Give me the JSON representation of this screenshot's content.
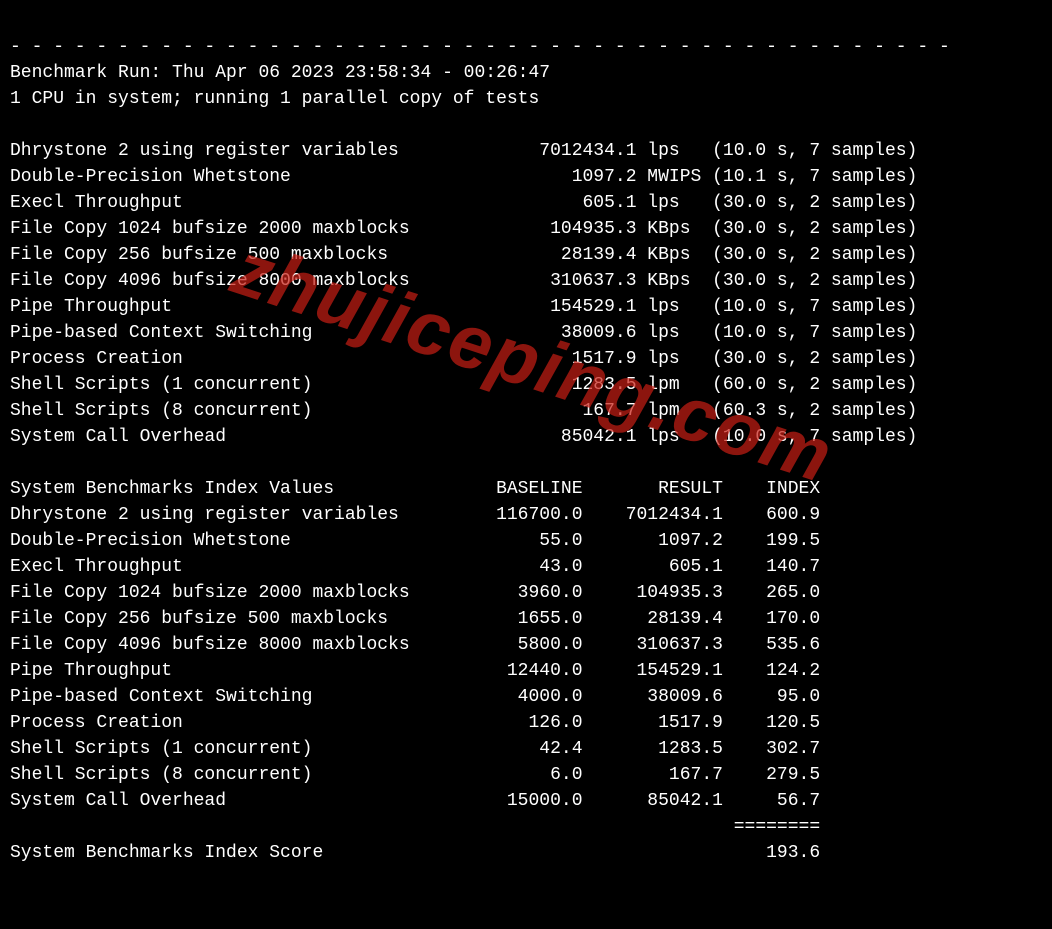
{
  "dashes": "- - - - - - - - - - - - - - - - - - - - - - - - - - - - - - - - - - - - - - - - - - - -",
  "header": {
    "run_line": "Benchmark Run: Thu Apr 06 2023 23:58:34 - 00:26:47",
    "cpu_line": "1 CPU in system; running 1 parallel copy of tests"
  },
  "benchmarks": [
    {
      "name": "Dhrystone 2 using register variables",
      "score": "7012434.1",
      "unit": "lps",
      "time": "10.0",
      "samples": "7"
    },
    {
      "name": "Double-Precision Whetstone",
      "score": "1097.2",
      "unit": "MWIPS",
      "time": "10.1",
      "samples": "7"
    },
    {
      "name": "Execl Throughput",
      "score": "605.1",
      "unit": "lps",
      "time": "30.0",
      "samples": "2"
    },
    {
      "name": "File Copy 1024 bufsize 2000 maxblocks",
      "score": "104935.3",
      "unit": "KBps",
      "time": "30.0",
      "samples": "2"
    },
    {
      "name": "File Copy 256 bufsize 500 maxblocks",
      "score": "28139.4",
      "unit": "KBps",
      "time": "30.0",
      "samples": "2"
    },
    {
      "name": "File Copy 4096 bufsize 8000 maxblocks",
      "score": "310637.3",
      "unit": "KBps",
      "time": "30.0",
      "samples": "2"
    },
    {
      "name": "Pipe Throughput",
      "score": "154529.1",
      "unit": "lps",
      "time": "10.0",
      "samples": "7"
    },
    {
      "name": "Pipe-based Context Switching",
      "score": "38009.6",
      "unit": "lps",
      "time": "10.0",
      "samples": "7"
    },
    {
      "name": "Process Creation",
      "score": "1517.9",
      "unit": "lps",
      "time": "30.0",
      "samples": "2"
    },
    {
      "name": "Shell Scripts (1 concurrent)",
      "score": "1283.5",
      "unit": "lpm",
      "time": "60.0",
      "samples": "2"
    },
    {
      "name": "Shell Scripts (8 concurrent)",
      "score": "167.7",
      "unit": "lpm",
      "time": "60.3",
      "samples": "2"
    },
    {
      "name": "System Call Overhead",
      "score": "85042.1",
      "unit": "lps",
      "time": "10.0",
      "samples": "7"
    }
  ],
  "index_header": {
    "title": "System Benchmarks Index Values",
    "baseline": "BASELINE",
    "result": "RESULT",
    "index": "INDEX"
  },
  "index_rows": [
    {
      "name": "Dhrystone 2 using register variables",
      "baseline": "116700.0",
      "result": "7012434.1",
      "index": "600.9"
    },
    {
      "name": "Double-Precision Whetstone",
      "baseline": "55.0",
      "result": "1097.2",
      "index": "199.5"
    },
    {
      "name": "Execl Throughput",
      "baseline": "43.0",
      "result": "605.1",
      "index": "140.7"
    },
    {
      "name": "File Copy 1024 bufsize 2000 maxblocks",
      "baseline": "3960.0",
      "result": "104935.3",
      "index": "265.0"
    },
    {
      "name": "File Copy 256 bufsize 500 maxblocks",
      "baseline": "1655.0",
      "result": "28139.4",
      "index": "170.0"
    },
    {
      "name": "File Copy 4096 bufsize 8000 maxblocks",
      "baseline": "5800.0",
      "result": "310637.3",
      "index": "535.6"
    },
    {
      "name": "Pipe Throughput",
      "baseline": "12440.0",
      "result": "154529.1",
      "index": "124.2"
    },
    {
      "name": "Pipe-based Context Switching",
      "baseline": "4000.0",
      "result": "38009.6",
      "index": "95.0"
    },
    {
      "name": "Process Creation",
      "baseline": "126.0",
      "result": "1517.9",
      "index": "120.5"
    },
    {
      "name": "Shell Scripts (1 concurrent)",
      "baseline": "42.4",
      "result": "1283.5",
      "index": "302.7"
    },
    {
      "name": "Shell Scripts (8 concurrent)",
      "baseline": "6.0",
      "result": "167.7",
      "index": "279.5"
    },
    {
      "name": "System Call Overhead",
      "baseline": "15000.0",
      "result": "85042.1",
      "index": "56.7"
    }
  ],
  "separator": "========",
  "final": {
    "label": "System Benchmarks Index Score",
    "value": "193.6"
  },
  "watermark": "zhujiceping.com"
}
